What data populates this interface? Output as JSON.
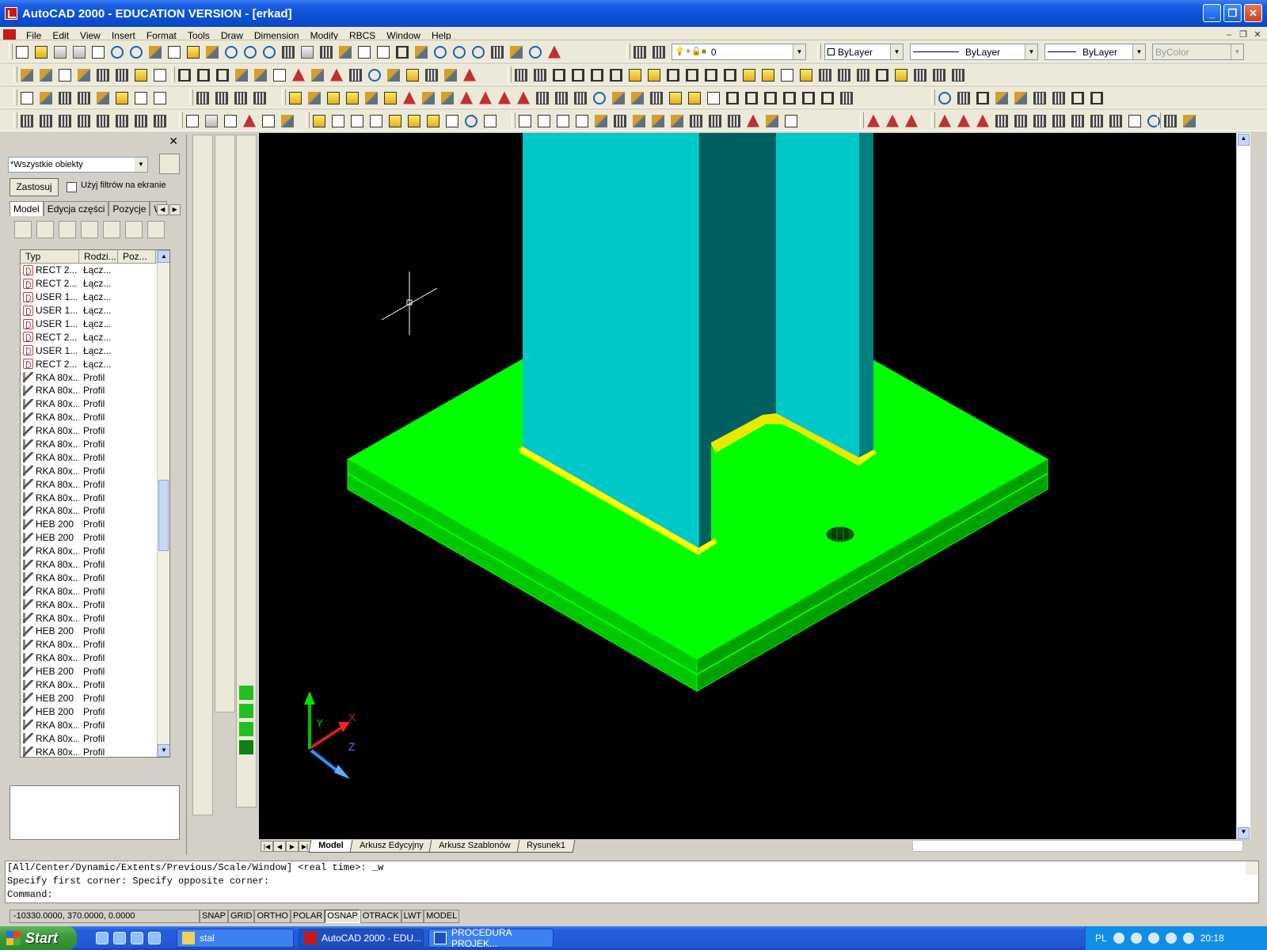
{
  "window": {
    "title": "AutoCAD 2000 - EDUCATION VERSION - [erkad]"
  },
  "menu": [
    "File",
    "Edit",
    "View",
    "Insert",
    "Format",
    "Tools",
    "Draw",
    "Dimension",
    "Modify",
    "RBCS",
    "Window",
    "Help"
  ],
  "properties_toolbar": {
    "layer": "0",
    "color": "ByLayer",
    "linetype": "ByLayer",
    "lineweight": "ByLayer",
    "plotstyle": "ByColor"
  },
  "left_panel": {
    "filter_value": "*Wszystkie obiekty",
    "apply_label": "Zastosuj",
    "screen_filter_label": "Użyj filtrów na ekranie",
    "tabs": [
      "Model",
      "Edycja części",
      "Pozycje",
      "W"
    ],
    "columns": [
      "Typ",
      "Rodzi...",
      "Poz..."
    ],
    "rows": [
      {
        "type": "RECT 2...",
        "kind": "Łącz...",
        "icon": "joint"
      },
      {
        "type": "RECT 2...",
        "kind": "Łącz...",
        "icon": "joint"
      },
      {
        "type": "USER 1...",
        "kind": "Łącz...",
        "icon": "joint"
      },
      {
        "type": "USER 1...",
        "kind": "Łącz...",
        "icon": "joint"
      },
      {
        "type": "USER 1...",
        "kind": "Łącz...",
        "icon": "joint"
      },
      {
        "type": "RECT 2...",
        "kind": "Łącz...",
        "icon": "joint"
      },
      {
        "type": "USER 1...",
        "kind": "Łącz...",
        "icon": "joint"
      },
      {
        "type": "RECT 2...",
        "kind": "Łącz...",
        "icon": "joint"
      },
      {
        "type": "RKA 80x...",
        "kind": "Profil",
        "icon": "profile"
      },
      {
        "type": "RKA 80x...",
        "kind": "Profil",
        "icon": "profile"
      },
      {
        "type": "RKA 80x...",
        "kind": "Profil",
        "icon": "profile"
      },
      {
        "type": "RKA 80x...",
        "kind": "Profil",
        "icon": "profile"
      },
      {
        "type": "RKA 80x...",
        "kind": "Profil",
        "icon": "profile"
      },
      {
        "type": "RKA 80x...",
        "kind": "Profil",
        "icon": "profile"
      },
      {
        "type": "RKA 80x...",
        "kind": "Profil",
        "icon": "profile"
      },
      {
        "type": "RKA 80x...",
        "kind": "Profil",
        "icon": "profile"
      },
      {
        "type": "RKA 80x...",
        "kind": "Profil",
        "icon": "profile"
      },
      {
        "type": "RKA 80x...",
        "kind": "Profil",
        "icon": "profile"
      },
      {
        "type": "RKA 80x...",
        "kind": "Profil",
        "icon": "profile"
      },
      {
        "type": "HEB 200",
        "kind": "Profil",
        "icon": "profile"
      },
      {
        "type": "HEB 200",
        "kind": "Profil",
        "icon": "profile"
      },
      {
        "type": "RKA 80x...",
        "kind": "Profil",
        "icon": "profile"
      },
      {
        "type": "RKA 80x...",
        "kind": "Profil",
        "icon": "profile"
      },
      {
        "type": "RKA 80x...",
        "kind": "Profil",
        "icon": "profile"
      },
      {
        "type": "RKA 80x...",
        "kind": "Profil",
        "icon": "profile"
      },
      {
        "type": "RKA 80x...",
        "kind": "Profil",
        "icon": "profile"
      },
      {
        "type": "RKA 80x...",
        "kind": "Profil",
        "icon": "profile"
      },
      {
        "type": "HEB 200",
        "kind": "Profil",
        "icon": "profile"
      },
      {
        "type": "RKA 80x...",
        "kind": "Profil",
        "icon": "profile"
      },
      {
        "type": "RKA 80x...",
        "kind": "Profil",
        "icon": "profile"
      },
      {
        "type": "HEB 200",
        "kind": "Profil",
        "icon": "profile"
      },
      {
        "type": "RKA 80x...",
        "kind": "Profil",
        "icon": "profile"
      },
      {
        "type": "HEB 200",
        "kind": "Profil",
        "icon": "profile"
      },
      {
        "type": "HEB 200",
        "kind": "Profil",
        "icon": "profile"
      },
      {
        "type": "RKA 80x...",
        "kind": "Profil",
        "icon": "profile"
      },
      {
        "type": "RKA 80x...",
        "kind": "Profil",
        "icon": "profile"
      },
      {
        "type": "RKA 80x...",
        "kind": "Profil",
        "icon": "profile"
      }
    ]
  },
  "viewport": {
    "ucs": {
      "x": "X",
      "y": "Y",
      "z": "Z"
    },
    "colors": {
      "plate": "#00ff00",
      "column": "#00c8c8",
      "weld": "#ffff00",
      "background": "#000000"
    }
  },
  "layout_tabs": [
    "Model",
    "Arkusz Edycyjny",
    "Arkusz Szablonów",
    "Rysunek1"
  ],
  "command_lines": [
    "[All/Center/Dynamic/Extents/Previous/Scale/Window] <real time>: _w",
    "Specify first corner: Specify opposite corner:",
    "Command:"
  ],
  "status": {
    "coords": "-10330.0000, 370.0000, 0.0000",
    "toggles": [
      {
        "label": "SNAP",
        "on": false
      },
      {
        "label": "GRID",
        "on": false
      },
      {
        "label": "ORTHO",
        "on": false
      },
      {
        "label": "POLAR",
        "on": false
      },
      {
        "label": "OSNAP",
        "on": true
      },
      {
        "label": "OTRACK",
        "on": false
      },
      {
        "label": "LWT",
        "on": false
      },
      {
        "label": "MODEL",
        "on": false
      }
    ]
  },
  "taskbar": {
    "start": "Start",
    "tasks": [
      {
        "label": "stal",
        "active": false
      },
      {
        "label": "AutoCAD 2000 - EDU...",
        "active": true
      },
      {
        "label": "PROCEDURA PROJEK...",
        "active": false
      }
    ],
    "lang": "PL",
    "clock": "20:18"
  }
}
